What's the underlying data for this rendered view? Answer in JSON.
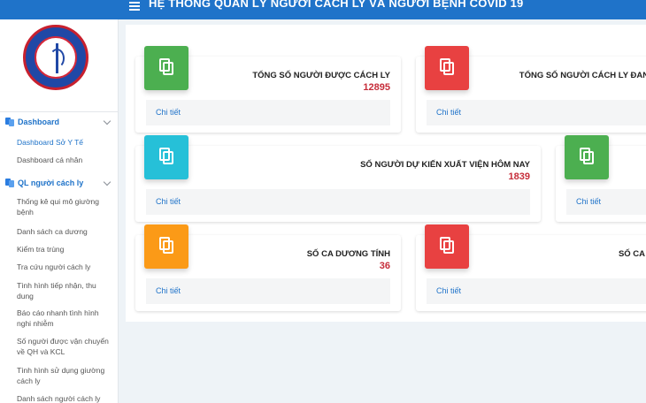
{
  "header": {
    "title": "HỆ THỐNG QUẢN LÝ NGƯỜI CÁCH LY VÀ NGƯỜI BỆNH COVID 19"
  },
  "sidebar": {
    "logo_text": "SỞ Y TẾ TP HỒ CHÍ MINH · DEPARTMENT OF HEALTH OF HCM CITY",
    "groups": [
      {
        "label": "Dashboard",
        "items": [
          "Dashboard Sở Y Tế",
          "Dashboard cá nhân"
        ]
      },
      {
        "label": "QL người cách ly",
        "items": [
          "Thống kê qui mô giường bệnh",
          "Danh sách ca dương",
          "Kiểm tra trùng",
          "Tra cứu người cách ly",
          "Tình hình tiếp nhận, thu dung",
          "Báo cáo nhanh tình hình nghi nhiễm",
          "Số người được vận chuyển về QH và KCL",
          "Tình hình sử dụng giường cách ly",
          "Danh sách người cách ly"
        ]
      }
    ]
  },
  "cards": [
    {
      "label": "TỔNG SỐ NGƯỜI ĐƯỢC CÁCH LY",
      "value": "12895",
      "link": "Chi tiết",
      "color": "#4caf50"
    },
    {
      "label": "TỔNG SỐ NGƯỜI CÁCH LY ĐANG HIỆ",
      "value": "",
      "link": "Chi tiết",
      "color": "#e84141"
    },
    {
      "label": "SỐ NGƯỜI DỰ KIẾN XUẤT VIỆN HÔM NAY",
      "value": "1839",
      "link": "Chi tiết",
      "color": "#26c0d8"
    },
    {
      "label": "",
      "value": "",
      "link": "Chi tiết",
      "color": "#4caf50"
    },
    {
      "label": "SỐ CA DƯƠNG TÍNH",
      "value": "36",
      "link": "Chi tiết",
      "color": "#fb9a17"
    },
    {
      "label": "SỐ CA TỬ",
      "value": "",
      "link": "Chi tiết",
      "color": "#e84141"
    }
  ]
}
